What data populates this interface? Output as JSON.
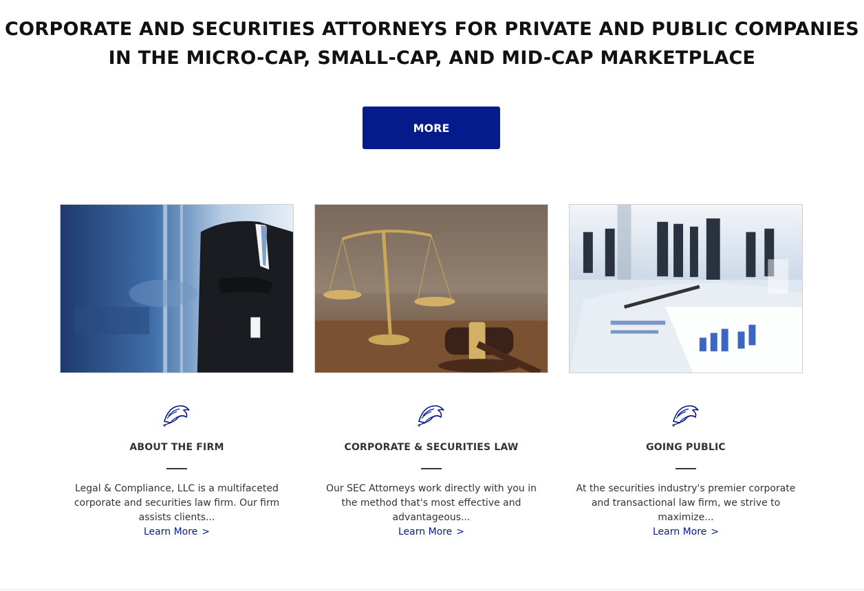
{
  "headline": {
    "line1": "CORPORATE AND SECURITIES ATTORNEYS FOR PRIVATE AND PUBLIC COMPANIES",
    "line2": "IN THE MICRO-CAP, SMALL-CAP, AND MID-CAP MARKETPLACE"
  },
  "more_button": {
    "label": "MORE"
  },
  "colors": {
    "brand": "#051a8b",
    "text": "#333333"
  },
  "cards": [
    {
      "image_icon": "businessman-photo",
      "logo_icon": "lion-icon",
      "title": "ABOUT THE FIRM",
      "text": "Legal & Compliance, LLC is a multifaceted corporate and securities law firm. Our firm assists clients...",
      "link": "Learn More",
      "link_chevron": ">"
    },
    {
      "image_icon": "scales-of-justice-photo",
      "logo_icon": "lion-icon",
      "title": "CORPORATE & SECURITIES LAW",
      "text": "Our SEC Attorneys work directly with you in the method that's most effective and advantageous...",
      "link": "Learn More",
      "link_chevron": ">"
    },
    {
      "image_icon": "business-meeting-photo",
      "logo_icon": "lion-icon",
      "title": "GOING PUBLIC",
      "text": "At the securities industry's premier corporate and transactional law firm, we strive to maximize...",
      "link": "Learn More",
      "link_chevron": ">"
    }
  ]
}
